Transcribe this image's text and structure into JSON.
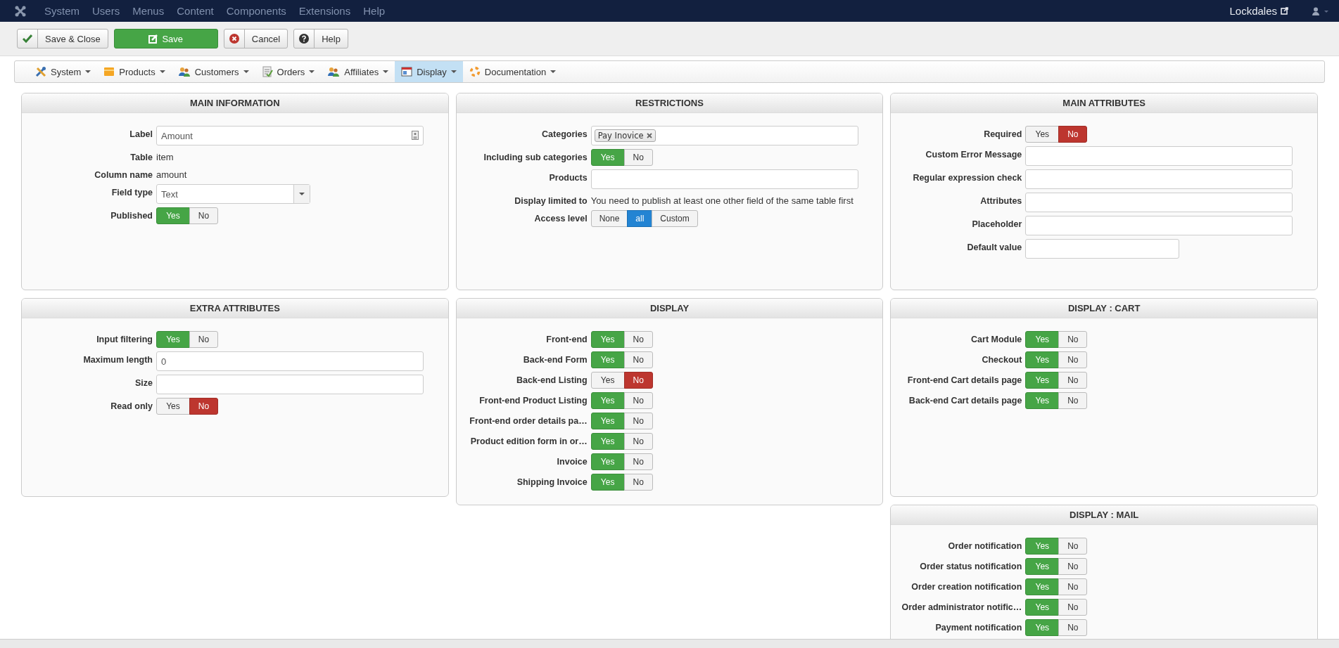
{
  "topbar": {
    "menu": [
      "System",
      "Users",
      "Menus",
      "Content",
      "Components",
      "Extensions",
      "Help"
    ],
    "site": "Lockdales"
  },
  "toolbar": [
    {
      "label": "Save & Close",
      "kind": "check"
    },
    {
      "label": "Save",
      "kind": "save"
    },
    {
      "label": "Cancel",
      "kind": "cancel"
    },
    {
      "label": "Help",
      "kind": "help"
    }
  ],
  "menu": [
    {
      "label": "System",
      "selected": false
    },
    {
      "label": "Products",
      "selected": false
    },
    {
      "label": "Customers",
      "selected": false
    },
    {
      "label": "Orders",
      "selected": false
    },
    {
      "label": "Affiliates",
      "selected": false
    },
    {
      "label": "Display",
      "selected": true
    },
    {
      "label": "Documentation",
      "selected": false
    }
  ],
  "columns": [
    [
      {
        "title": "MAIN INFORMATION",
        "rows": [
          {
            "label": "Label",
            "kind": "icon-input",
            "value": "Amount"
          },
          {
            "label": "Table",
            "kind": "static",
            "value": "item"
          },
          {
            "label": "Column name",
            "kind": "static",
            "value": "amount"
          },
          {
            "label": "Field type",
            "kind": "select",
            "value": "Text"
          },
          {
            "label": "Published",
            "kind": "yesno",
            "options": [
              {
                "label": "Yes",
                "selected": true
              },
              {
                "label": "No",
                "selected": false
              }
            ]
          }
        ]
      },
      {
        "title": "EXTRA ATTRIBUTES",
        "rows": [
          {
            "label": "Input filtering",
            "kind": "yesno",
            "options": [
              {
                "label": "Yes",
                "selected": true
              },
              {
                "label": "No",
                "selected": false
              }
            ]
          },
          {
            "label": "Maximum length",
            "kind": "input",
            "value": "0"
          },
          {
            "label": "Size",
            "kind": "input"
          },
          {
            "label": "Read only",
            "kind": "yesno",
            "options": [
              {
                "label": "Yes",
                "selected": false
              },
              {
                "label": "No",
                "selected": true
              }
            ]
          }
        ]
      }
    ],
    [
      {
        "title": "RESTRICTIONS",
        "rows": [
          {
            "label": "Categories",
            "kind": "tags",
            "tags": [
              "Pay Inovice"
            ]
          },
          {
            "label": "Including sub categories",
            "kind": "yesno",
            "options": [
              {
                "label": "Yes",
                "selected": true
              },
              {
                "label": "No",
                "selected": false
              }
            ]
          },
          {
            "label": "Products",
            "kind": "input"
          },
          {
            "label": "Display limited to",
            "kind": "static",
            "value": "You need to publish at least one other field of the same table first"
          },
          {
            "label": "Access level",
            "kind": "radio",
            "options": [
              {
                "label": "None",
                "selected": false
              },
              {
                "label": "all",
                "selected": true
              },
              {
                "label": "Custom",
                "selected": false
              }
            ]
          }
        ]
      },
      {
        "title": "DISPLAY",
        "rows": [
          {
            "label": "Front-end",
            "kind": "yesno",
            "options": [
              {
                "label": "Yes",
                "selected": true
              },
              {
                "label": "No",
                "selected": false
              }
            ]
          },
          {
            "label": "Back-end Form",
            "kind": "yesno",
            "options": [
              {
                "label": "Yes",
                "selected": true
              },
              {
                "label": "No",
                "selected": false
              }
            ]
          },
          {
            "label": "Back-end Listing",
            "kind": "yesno",
            "options": [
              {
                "label": "Yes",
                "selected": false
              },
              {
                "label": "No",
                "selected": true
              }
            ]
          },
          {
            "label": "Front-end Product Listing",
            "kind": "yesno",
            "options": [
              {
                "label": "Yes",
                "selected": true
              },
              {
                "label": "No",
                "selected": false
              }
            ]
          },
          {
            "label": "Front-end order details pa…",
            "kind": "yesno",
            "options": [
              {
                "label": "Yes",
                "selected": true
              },
              {
                "label": "No",
                "selected": false
              }
            ]
          },
          {
            "label": "Product edition form in or…",
            "kind": "yesno",
            "options": [
              {
                "label": "Yes",
                "selected": true
              },
              {
                "label": "No",
                "selected": false
              }
            ]
          },
          {
            "label": "Invoice",
            "kind": "yesno",
            "options": [
              {
                "label": "Yes",
                "selected": true
              },
              {
                "label": "No",
                "selected": false
              }
            ]
          },
          {
            "label": "Shipping Invoice",
            "kind": "yesno",
            "options": [
              {
                "label": "Yes",
                "selected": true
              },
              {
                "label": "No",
                "selected": false
              }
            ]
          }
        ]
      }
    ],
    [
      {
        "title": "MAIN ATTRIBUTES",
        "rows": [
          {
            "label": "Required",
            "kind": "yesno",
            "options": [
              {
                "label": "Yes",
                "selected": false
              },
              {
                "label": "No",
                "selected": true
              }
            ]
          },
          {
            "label": "Custom Error Message",
            "kind": "input"
          },
          {
            "label": "Regular expression check",
            "kind": "input"
          },
          {
            "label": "Attributes",
            "kind": "input"
          },
          {
            "label": "Placeholder",
            "kind": "input"
          },
          {
            "label": "Default value",
            "kind": "short-input"
          }
        ]
      },
      {
        "title": "DISPLAY : CART",
        "rows": [
          {
            "label": "Cart Module",
            "kind": "yesno",
            "options": [
              {
                "label": "Yes",
                "selected": true
              },
              {
                "label": "No",
                "selected": false
              }
            ]
          },
          {
            "label": "Checkout",
            "kind": "yesno",
            "options": [
              {
                "label": "Yes",
                "selected": true
              },
              {
                "label": "No",
                "selected": false
              }
            ]
          },
          {
            "label": "Front-end Cart details page",
            "kind": "yesno",
            "options": [
              {
                "label": "Yes",
                "selected": true
              },
              {
                "label": "No",
                "selected": false
              }
            ]
          },
          {
            "label": "Back-end Cart details page",
            "kind": "yesno",
            "options": [
              {
                "label": "Yes",
                "selected": true
              },
              {
                "label": "No",
                "selected": false
              }
            ]
          }
        ]
      },
      {
        "title": "DISPLAY : MAIL",
        "rows": [
          {
            "label": "Order notification",
            "kind": "yesno",
            "options": [
              {
                "label": "Yes",
                "selected": true
              },
              {
                "label": "No",
                "selected": false
              }
            ]
          },
          {
            "label": "Order status notification",
            "kind": "yesno",
            "options": [
              {
                "label": "Yes",
                "selected": true
              },
              {
                "label": "No",
                "selected": false
              }
            ]
          },
          {
            "label": "Order creation notification",
            "kind": "yesno",
            "options": [
              {
                "label": "Yes",
                "selected": true
              },
              {
                "label": "No",
                "selected": false
              }
            ]
          },
          {
            "label": "Order administrator notific…",
            "kind": "yesno",
            "options": [
              {
                "label": "Yes",
                "selected": true
              },
              {
                "label": "No",
                "selected": false
              }
            ]
          },
          {
            "label": "Payment notification",
            "kind": "yesno",
            "options": [
              {
                "label": "Yes",
                "selected": true
              },
              {
                "label": "No",
                "selected": false
              }
            ]
          }
        ]
      }
    ]
  ]
}
